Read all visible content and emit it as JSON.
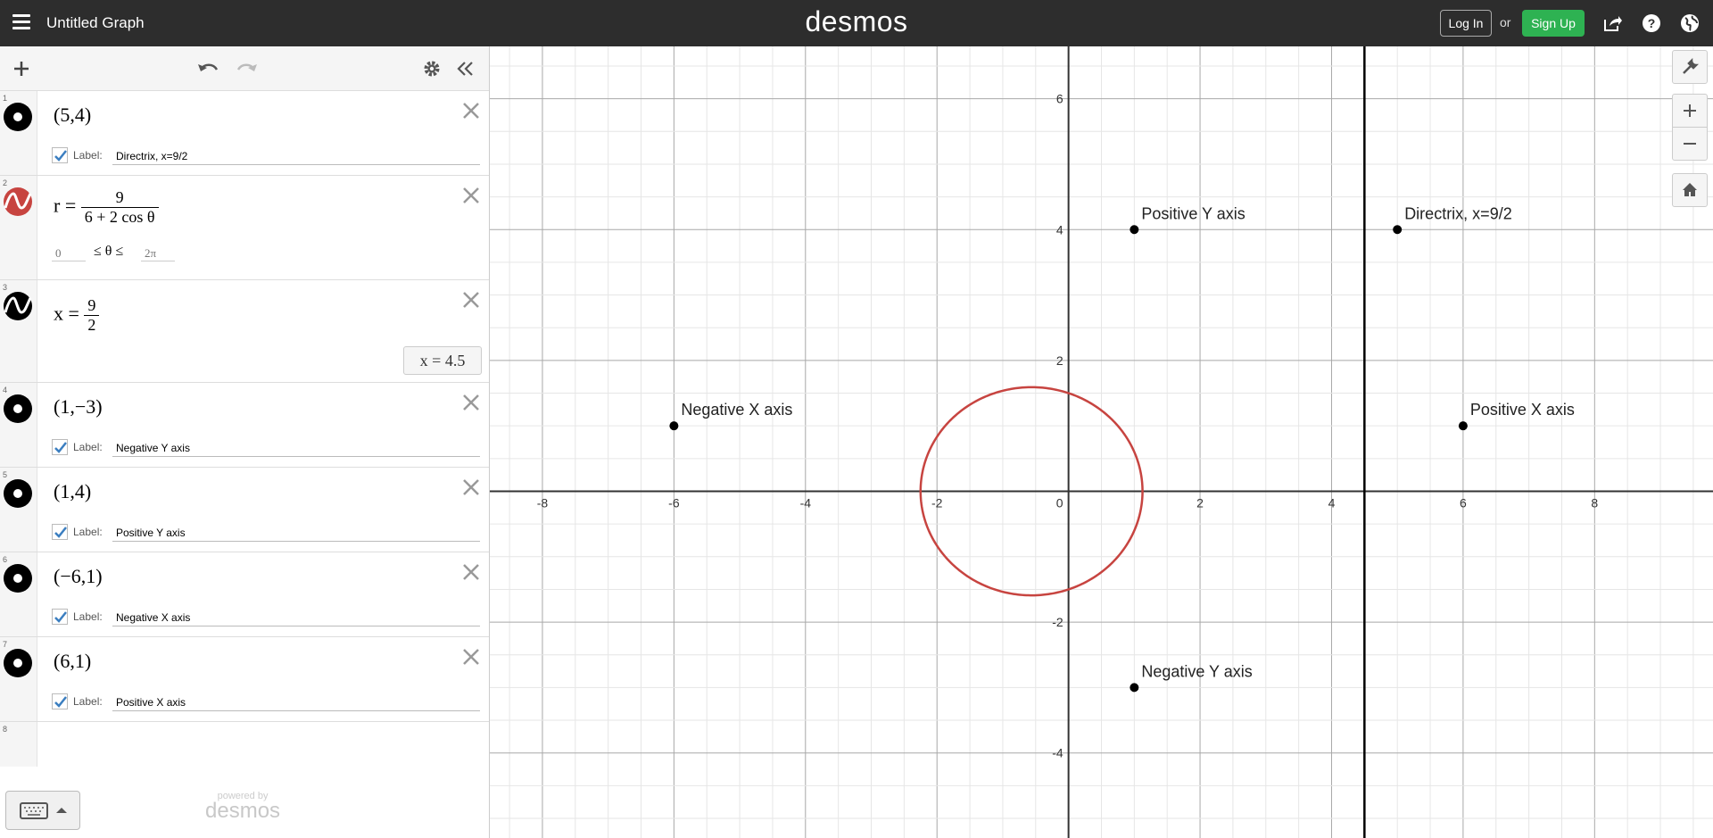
{
  "header": {
    "title": "Untitled Graph",
    "brand": "desmos",
    "login": "Log In",
    "or": "or",
    "signup": "Sign Up"
  },
  "panel": {
    "rows": [
      {
        "num": "1",
        "type": "point",
        "color": "#000000",
        "math": "(5,4)",
        "label_text": "Label:",
        "label_value": "Directrix, x=9/2"
      },
      {
        "num": "2",
        "type": "polar",
        "color": "#c74440",
        "lhs": "r =",
        "numerator": "9",
        "denominator": "6 + 2 cos θ",
        "domain_min": "0",
        "domain_mid": "≤ θ ≤",
        "domain_max": "2π"
      },
      {
        "num": "3",
        "type": "line",
        "color": "#000000",
        "lhs": "x =",
        "numerator": "9",
        "denominator": "2",
        "result": "x = 4.5"
      },
      {
        "num": "4",
        "type": "point",
        "color": "#000000",
        "math": "(1,−3)",
        "label_text": "Label:",
        "label_value": "Negative Y axis"
      },
      {
        "num": "5",
        "type": "point",
        "color": "#000000",
        "math": "(1,4)",
        "label_text": "Label:",
        "label_value": "Positive Y axis"
      },
      {
        "num": "6",
        "type": "point",
        "color": "#000000",
        "math": "(−6,1)",
        "label_text": "Label:",
        "label_value": "Negative X axis"
      },
      {
        "num": "7",
        "type": "point",
        "color": "#000000",
        "math": "(6,1)",
        "label_text": "Label:",
        "label_value": "Positive X axis"
      },
      {
        "num": "8",
        "type": "empty"
      }
    ],
    "powered_by": "powered by",
    "powered_brand": "desmos"
  },
  "graph": {
    "x_range": [
      -8.8,
      9.8
    ],
    "y_range": [
      -5.3,
      6.8
    ],
    "x_ticks": [
      "-8",
      "-6",
      "-4",
      "-2",
      "0",
      "2",
      "4",
      "6",
      "8"
    ],
    "y_ticks": [
      "6",
      "4",
      "2",
      "-2",
      "-4"
    ],
    "points": [
      {
        "x": 5,
        "y": 4,
        "label": "Directrix, x=9/2"
      },
      {
        "x": 1,
        "y": -3,
        "label": "Negative Y axis"
      },
      {
        "x": 1,
        "y": 4,
        "label": "Positive Y axis"
      },
      {
        "x": -6,
        "y": 1,
        "label": "Negative X axis"
      },
      {
        "x": 6,
        "y": 1,
        "label": "Positive X axis"
      }
    ],
    "polar": {
      "numerator": 9,
      "a": 6,
      "b": 2
    },
    "vertical_line_x": 4.5,
    "curve_color": "#c74440"
  }
}
